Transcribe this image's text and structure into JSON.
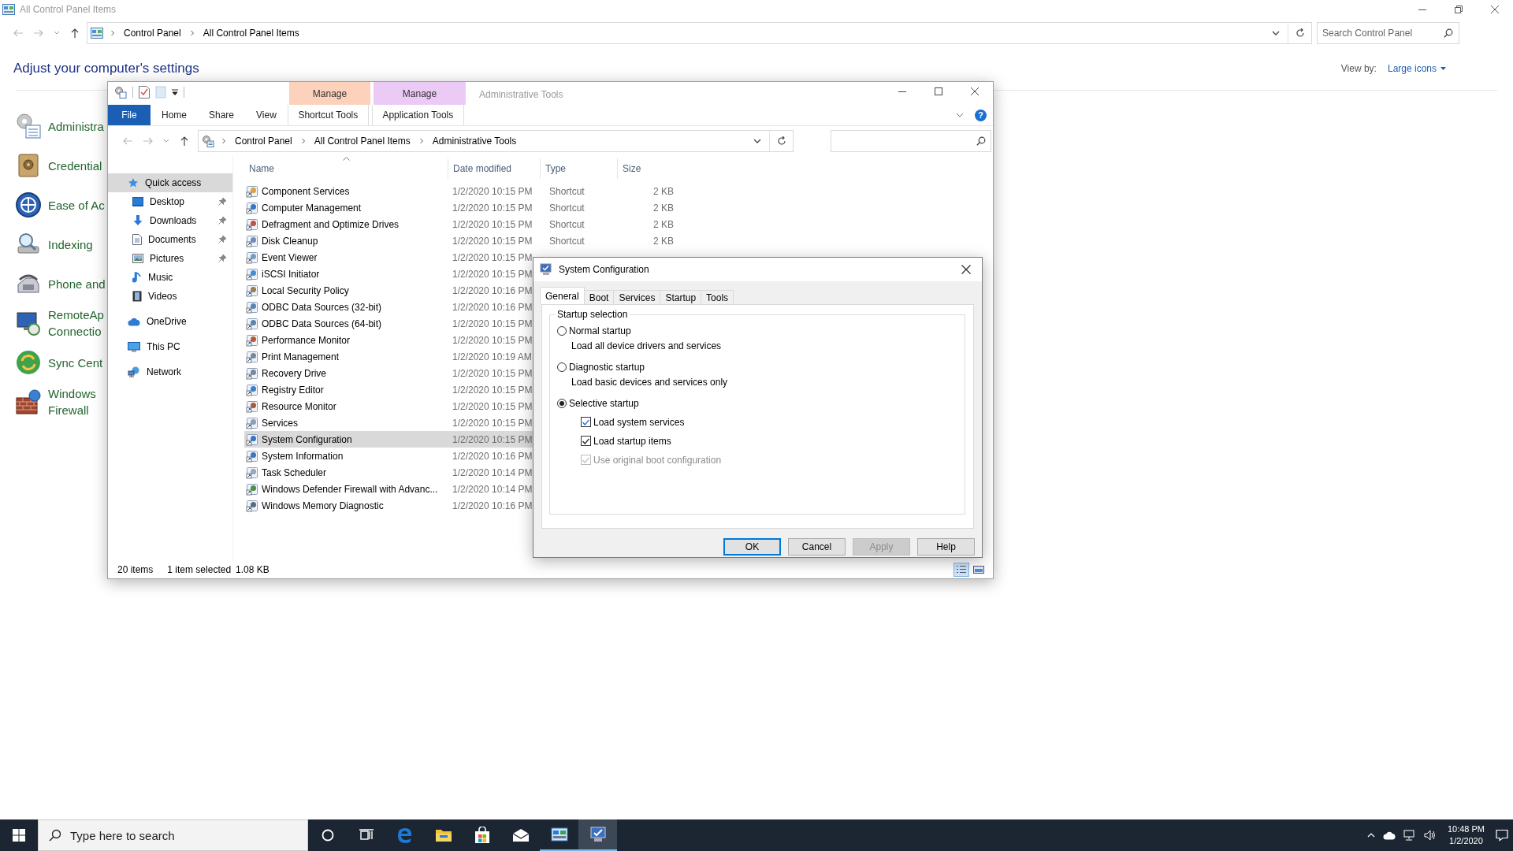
{
  "control_panel": {
    "title": "All Control Panel Items",
    "breadcrumb": [
      "Control Panel",
      "All Control Panel Items"
    ],
    "search": {
      "placeholder": "Search Control Panel"
    },
    "heading": "Adjust your computer's settings",
    "view_by": {
      "label": "View by:",
      "value": "Large icons"
    },
    "items": [
      {
        "lines": [
          "Administra"
        ]
      },
      {
        "lines": [
          "Credential"
        ]
      },
      {
        "lines": [
          "Ease of Ac"
        ]
      },
      {
        "lines": [
          "Indexing"
        ]
      },
      {
        "lines": [
          "Phone and"
        ]
      },
      {
        "lines": [
          "RemoteAp",
          "Connectio"
        ]
      },
      {
        "lines": [
          "Sync Cent"
        ]
      },
      {
        "lines": [
          "Windows",
          "Firewall"
        ]
      }
    ]
  },
  "explorer": {
    "title": "Administrative Tools",
    "ribbon": {
      "tabs": [
        {
          "label": "File",
          "kind": "file"
        },
        {
          "label": "Home",
          "kind": "tab"
        },
        {
          "label": "Share",
          "kind": "tab"
        },
        {
          "label": "View",
          "kind": "tab"
        },
        {
          "label": "Shortcut Tools",
          "kind": "contextual",
          "group": "Manage",
          "color": "#fcd2bc"
        },
        {
          "label": "Application Tools",
          "kind": "contextual",
          "group": "Manage",
          "color": "#eccaf6"
        }
      ],
      "help": "?"
    },
    "breadcrumb": [
      "Control Panel",
      "All Control Panel Items",
      "Administrative Tools"
    ],
    "nav": [
      {
        "label": "Quick access",
        "selected": true,
        "children": [
          {
            "label": "Desktop",
            "pinned": true,
            "selected": false
          },
          {
            "label": "Downloads",
            "pinned": true,
            "selected": false
          },
          {
            "label": "Documents",
            "pinned": true,
            "selected": false
          },
          {
            "label": "Pictures",
            "pinned": true,
            "selected": false
          },
          {
            "label": "Music",
            "pinned": false,
            "selected": false
          },
          {
            "label": "Videos",
            "pinned": false,
            "selected": false
          }
        ]
      },
      {
        "label": "OneDrive",
        "selected": false
      },
      {
        "label": "This PC",
        "selected": false
      },
      {
        "label": "Network",
        "selected": false
      }
    ],
    "columns": [
      {
        "label": "Name",
        "sorted": true
      },
      {
        "label": "Date modified",
        "sorted": false
      },
      {
        "label": "Type",
        "sorted": false
      },
      {
        "label": "Size",
        "sorted": false
      }
    ],
    "rows": [
      {
        "name": "Component Services",
        "date": "1/2/2020 10:15 PM",
        "type": "Shortcut",
        "size": "2 KB",
        "selected": false
      },
      {
        "name": "Computer Management",
        "date": "1/2/2020 10:15 PM",
        "type": "Shortcut",
        "size": "2 KB",
        "selected": false
      },
      {
        "name": "Defragment and Optimize Drives",
        "date": "1/2/2020 10:15 PM",
        "type": "Shortcut",
        "size": "2 KB",
        "selected": false
      },
      {
        "name": "Disk Cleanup",
        "date": "1/2/2020 10:15 PM",
        "type": "Shortcut",
        "size": "2 KB",
        "selected": false
      },
      {
        "name": "Event Viewer",
        "date": "1/2/2020 10:15 PM",
        "selected": false
      },
      {
        "name": "iSCSI Initiator",
        "date": "1/2/2020 10:15 PM",
        "selected": false
      },
      {
        "name": "Local Security Policy",
        "date": "1/2/2020 10:16 PM",
        "selected": false
      },
      {
        "name": "ODBC Data Sources (32-bit)",
        "date": "1/2/2020 10:16 PM",
        "selected": false
      },
      {
        "name": "ODBC Data Sources (64-bit)",
        "date": "1/2/2020 10:15 PM",
        "selected": false
      },
      {
        "name": "Performance Monitor",
        "date": "1/2/2020 10:15 PM",
        "selected": false
      },
      {
        "name": "Print Management",
        "date": "1/2/2020 10:19 AM",
        "selected": false
      },
      {
        "name": "Recovery Drive",
        "date": "1/2/2020 10:15 PM",
        "selected": false
      },
      {
        "name": "Registry Editor",
        "date": "1/2/2020 10:15 PM",
        "selected": false
      },
      {
        "name": "Resource Monitor",
        "date": "1/2/2020 10:15 PM",
        "selected": false
      },
      {
        "name": "Services",
        "date": "1/2/2020 10:15 PM",
        "selected": false
      },
      {
        "name": "System Configuration",
        "date": "1/2/2020 10:15 PM",
        "selected": true
      },
      {
        "name": "System Information",
        "date": "1/2/2020 10:16 PM",
        "selected": false
      },
      {
        "name": "Task Scheduler",
        "date": "1/2/2020 10:14 PM",
        "selected": false
      },
      {
        "name": "Windows Defender Firewall with Advanc...",
        "date": "1/2/2020 10:14 PM",
        "selected": false
      },
      {
        "name": "Windows Memory Diagnostic",
        "date": "1/2/2020 10:16 PM",
        "selected": false
      }
    ],
    "status": {
      "count": "20 items",
      "selection": "1 item selected",
      "size": "1.08 KB"
    },
    "view_toggles": [
      {
        "kind": "details",
        "selected": true
      },
      {
        "kind": "large-icons",
        "selected": false
      }
    ]
  },
  "dialog": {
    "title": "System Configuration",
    "tabs": [
      {
        "label": "General",
        "selected": true
      },
      {
        "label": "Boot",
        "selected": false
      },
      {
        "label": "Services",
        "selected": false
      },
      {
        "label": "Startup",
        "selected": false
      },
      {
        "label": "Tools",
        "selected": false
      }
    ],
    "group": "Startup selection",
    "options": [
      {
        "label": "Normal startup",
        "description": "Load all device drivers and services",
        "selected": false
      },
      {
        "label": "Diagnostic startup",
        "description": "Load basic devices and services only",
        "selected": false
      },
      {
        "label": "Selective startup",
        "selected": true,
        "checkboxes": [
          {
            "label": "Load system services",
            "checked": true,
            "disabled": false
          },
          {
            "label": "Load startup items",
            "checked": true,
            "disabled": false
          },
          {
            "label": "Use original boot configuration",
            "checked": true,
            "disabled": true
          }
        ]
      }
    ],
    "buttons": [
      {
        "label": "OK",
        "default": true,
        "disabled": false
      },
      {
        "label": "Cancel",
        "default": false,
        "disabled": false
      },
      {
        "label": "Apply",
        "default": false,
        "disabled": true
      },
      {
        "label": "Help",
        "default": false,
        "disabled": false
      }
    ]
  },
  "taskbar": {
    "search": {
      "placeholder": "Type here to search"
    },
    "apps": [
      {
        "kind": "edge",
        "running": false,
        "selected": false
      },
      {
        "kind": "file-explorer",
        "running": false,
        "selected": false
      },
      {
        "kind": "store",
        "running": false,
        "selected": false
      },
      {
        "kind": "mail",
        "running": false,
        "selected": false
      },
      {
        "kind": "control-panel",
        "running": true,
        "selected": false
      },
      {
        "kind": "system-configuration",
        "running": true,
        "selected": true
      }
    ],
    "clock": {
      "time": "10:48 PM",
      "date": "1/2/2020"
    }
  }
}
